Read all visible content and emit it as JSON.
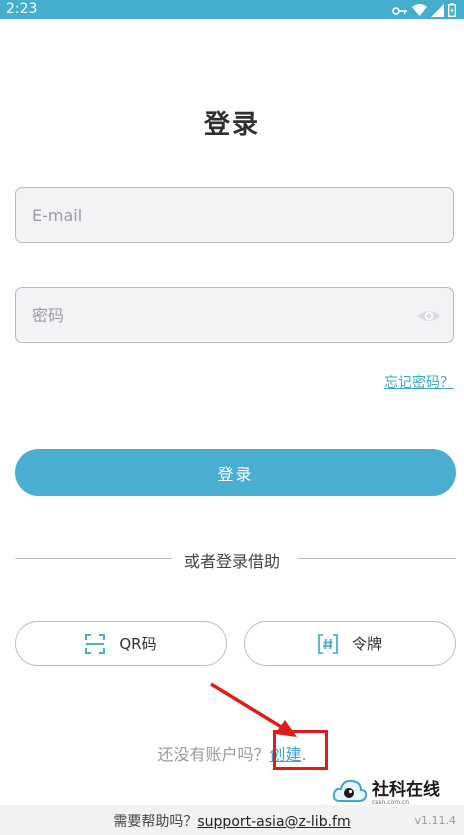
{
  "status_bar": {
    "time": "2:23"
  },
  "title": "登录",
  "email_field": {
    "placeholder": "E-mail"
  },
  "password_field": {
    "placeholder": "密码"
  },
  "forgot_password": "忘记密码？",
  "login_button": "登录",
  "divider_text": "或者登录借助",
  "alt_login": {
    "qr_label": "QR码",
    "token_label": "令牌"
  },
  "signup": {
    "prompt": "还没有账户吗？",
    "create": "创建",
    "period": "."
  },
  "footer": {
    "help_prefix": "需要帮助吗？",
    "email": "support-asia@z-lib.fm",
    "version": "v1.11.4"
  },
  "watermark": {
    "text": "社科在线",
    "sub": "cssn.com.cn"
  },
  "colors": {
    "accent": "#4aaed0",
    "status_bar": "#45aecd",
    "highlight": "#e01b1b"
  }
}
